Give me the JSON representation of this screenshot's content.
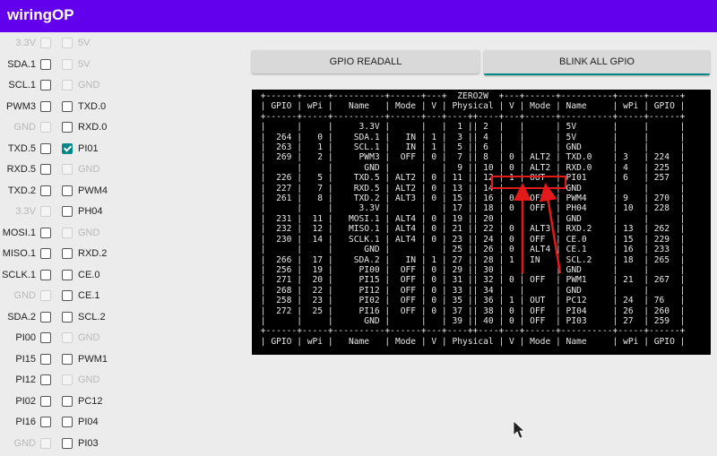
{
  "app": {
    "title": "wiringOP"
  },
  "buttons": {
    "readall": "GPIO READALL",
    "blink": "BLINK ALL GPIO"
  },
  "pins": [
    {
      "left": "3.3V",
      "left_enabled": false,
      "left_checked": false,
      "right": "5V",
      "right_enabled": false,
      "right_checked": false
    },
    {
      "left": "SDA.1",
      "left_enabled": true,
      "left_checked": false,
      "right": "5V",
      "right_enabled": false,
      "right_checked": false
    },
    {
      "left": "SCL.1",
      "left_enabled": true,
      "left_checked": false,
      "right": "GND",
      "right_enabled": false,
      "right_checked": false
    },
    {
      "left": "PWM3",
      "left_enabled": true,
      "left_checked": false,
      "right": "TXD.0",
      "right_enabled": true,
      "right_checked": false
    },
    {
      "left": "GND",
      "left_enabled": false,
      "left_checked": false,
      "right": "RXD.0",
      "right_enabled": true,
      "right_checked": false
    },
    {
      "left": "TXD.5",
      "left_enabled": true,
      "left_checked": false,
      "right": "PI01",
      "right_enabled": true,
      "right_checked": true
    },
    {
      "left": "RXD.5",
      "left_enabled": true,
      "left_checked": false,
      "right": "GND",
      "right_enabled": false,
      "right_checked": false
    },
    {
      "left": "TXD.2",
      "left_enabled": true,
      "left_checked": false,
      "right": "PWM4",
      "right_enabled": true,
      "right_checked": false
    },
    {
      "left": "3.3V",
      "left_enabled": false,
      "left_checked": false,
      "right": "PH04",
      "right_enabled": true,
      "right_checked": false
    },
    {
      "left": "MOSI.1",
      "left_enabled": true,
      "left_checked": false,
      "right": "GND",
      "right_enabled": false,
      "right_checked": false
    },
    {
      "left": "MISO.1",
      "left_enabled": true,
      "left_checked": false,
      "right": "RXD.2",
      "right_enabled": true,
      "right_checked": false
    },
    {
      "left": "SCLK.1",
      "left_enabled": true,
      "left_checked": false,
      "right": "CE.0",
      "right_enabled": true,
      "right_checked": false
    },
    {
      "left": "GND",
      "left_enabled": false,
      "left_checked": false,
      "right": "CE.1",
      "right_enabled": true,
      "right_checked": false
    },
    {
      "left": "SDA.2",
      "left_enabled": true,
      "left_checked": false,
      "right": "SCL.2",
      "right_enabled": true,
      "right_checked": false
    },
    {
      "left": "PI00",
      "left_enabled": true,
      "left_checked": false,
      "right": "GND",
      "right_enabled": false,
      "right_checked": false
    },
    {
      "left": "PI15",
      "left_enabled": true,
      "left_checked": false,
      "right": "PWM1",
      "right_enabled": true,
      "right_checked": false
    },
    {
      "left": "PI12",
      "left_enabled": true,
      "left_checked": false,
      "right": "GND",
      "right_enabled": false,
      "right_checked": false
    },
    {
      "left": "PI02",
      "left_enabled": true,
      "left_checked": false,
      "right": "PC12",
      "right_enabled": true,
      "right_checked": false
    },
    {
      "left": "PI16",
      "left_enabled": true,
      "left_checked": false,
      "right": "PI04",
      "right_enabled": true,
      "right_checked": false
    },
    {
      "left": "GND",
      "left_enabled": false,
      "left_checked": false,
      "right": "PI03",
      "right_enabled": true,
      "right_checked": false
    }
  ],
  "terminal": {
    "lines": [
      " +------+-----+----------+------+---+  ZERO2W  +---+------+----------+-----+------+",
      " | GPIO | wPi |   Name   | Mode | V | Physical | V | Mode | Name     | wPi | GPIO |",
      " +------+-----+----------+------+---+----++----+---+------+----------+-----+------+",
      " |      |     |     3.3V |      |   |  1 || 2  |   |      | 5V       |     |      |",
      " |  264 |   0 |    SDA.1 |   IN | 1 |  3 || 4  |   |      | 5V       |     |      |",
      " |  263 |   1 |    SCL.1 |   IN | 1 |  5 || 6  |   |      | GND      |     |      |",
      " |  269 |   2 |     PWM3 |  OFF | 0 |  7 || 8  | 0 | ALT2 | TXD.0    | 3   | 224  |",
      " |      |     |      GND |      |   |  9 || 10 | 0 | ALT2 | RXD.0    | 4   | 225  |",
      " |  226 |   5 |    TXD.5 | ALT2 | 0 | 11 || 12 | 1 | OUT  | PI01     | 6   | 257  |",
      " |  227 |   7 |    RXD.5 | ALT2 | 0 | 13 || 14 |   |      | GND      |     |      |",
      " |  261 |   8 |    TXD.2 | ALT3 | 0 | 15 || 16 | 0 | OFF  | PWM4     | 9   | 270  |",
      " |      |     |     3.3V |      |   | 17 || 18 | 0 | OFF  | PH04     | 10  | 228  |",
      " |  231 |  11 |   MOSI.1 | ALT4 | 0 | 19 || 20 |   |      | GND      |     |      |",
      " |  232 |  12 |   MISO.1 | ALT4 | 0 | 21 || 22 | 0 | ALT3 | RXD.2    | 13  | 262  |",
      " |  230 |  14 |   SCLK.1 | ALT4 | 0 | 23 || 24 | 0 | OFF  | CE.0     | 15  | 229  |",
      " |      |     |      GND |      |   | 25 || 26 | 0 | ALT4 | CE.1     | 16  | 233  |",
      " |  266 |  17 |    SDA.2 |   IN | 1 | 27 || 28 | 1 | IN   | SCL.2    | 18  | 265  |",
      " |  256 |  19 |     PI00 |  OFF | 0 | 29 || 30 |   |      | GND      |     |      |",
      " |  271 |  20 |     PI15 |  OFF | 0 | 31 || 32 | 0 | OFF  | PWM1     | 21  | 267  |",
      " |  268 |  22 |     PI12 |  OFF | 0 | 33 || 34 |   |      | GND      |     |      |",
      " |  258 |  23 |     PI02 |  OFF | 0 | 35 || 36 | 1 | OUT  | PC12     | 24  | 76   |",
      " |  272 |  25 |     PI16 |  OFF | 0 | 37 || 38 | 0 | OFF  | PI04     | 26  | 260  |",
      " |      |     |      GND |      |   | 39 || 40 | 0 | OFF  | PI03     | 27  | 259  |",
      " +------+-----+----------+------+---+----++----+---+------+----------+-----+------+",
      " | GPIO | wPi |   Name   | Mode | V | Physical | V | Mode | Name     | wPi | GPIO |"
    ]
  },
  "colors": {
    "appbar": "#6200ee",
    "accent": "#018786",
    "highlight": "#e31a1a"
  }
}
